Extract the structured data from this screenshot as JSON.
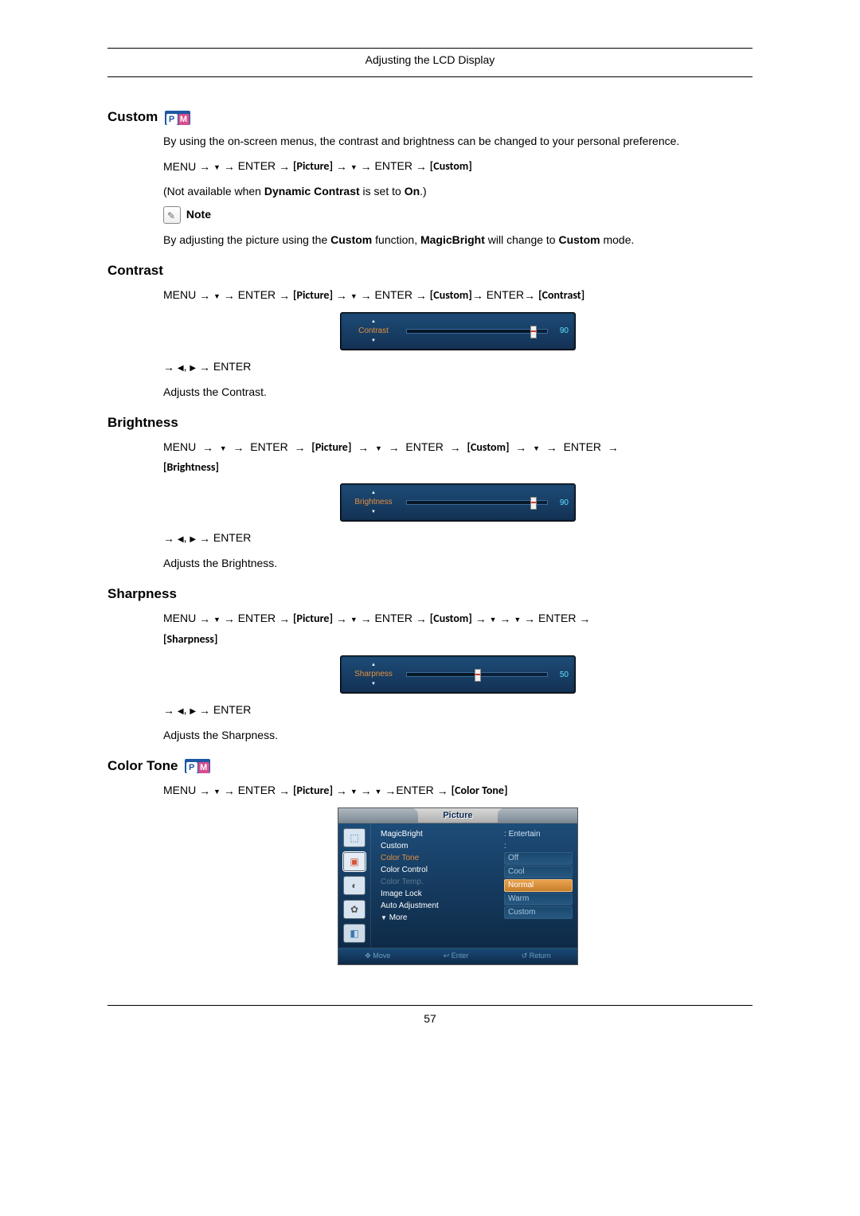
{
  "header": {
    "title": "Adjusting the LCD Display"
  },
  "footer": {
    "page": "57"
  },
  "nav": {
    "menu": "MENU",
    "enter": "ENTER",
    "picture": "Picture",
    "custom": "Custom",
    "contrast": "Contrast",
    "brightness": "Brightness",
    "sharpness": "Sharpness",
    "color_tone": "Color Tone"
  },
  "sections": {
    "custom": {
      "heading": "Custom",
      "para1": "By using the on-screen menus, the contrast and brightness can be changed to your personal preference.",
      "not_avail_prefix": "(Not available when ",
      "not_avail_bold": "Dynamic Contrast",
      "not_avail_mid": " is set to ",
      "not_avail_bold2": "On",
      "not_avail_suffix": ".)",
      "note_label": "Note",
      "note_text_a": "By adjusting the picture using the ",
      "note_text_bold1": "Custom",
      "note_text_b": " function, ",
      "note_text_bold2": "MagicBright",
      "note_text_c": " will change to ",
      "note_text_bold3": "Custom",
      "note_text_d": " mode."
    },
    "contrast": {
      "heading": "Contrast",
      "desc": "Adjusts the Contrast.",
      "slider_label": "Contrast",
      "slider_value": "90",
      "slider_pct": 90
    },
    "brightness": {
      "heading": "Brightness",
      "desc": "Adjusts the Brightness.",
      "slider_label": "Brightness",
      "slider_value": "90",
      "slider_pct": 90
    },
    "sharpness": {
      "heading": "Sharpness",
      "desc": "Adjusts the Sharpness.",
      "slider_label": "Sharpness",
      "slider_value": "50",
      "slider_pct": 50
    },
    "color_tone": {
      "heading": "Color Tone"
    }
  },
  "osd": {
    "title": "Picture",
    "labels": {
      "magicbright": "MagicBright",
      "custom": "Custom",
      "color_tone": "Color Tone",
      "color_control": "Color Control",
      "color_temp": "Color Temp.",
      "image_lock": "Image Lock",
      "auto_adjustment": "Auto Adjustment",
      "more": "More"
    },
    "mb_value": "Entertain",
    "options": [
      "Off",
      "Cool",
      "Normal",
      "Warm",
      "Custom"
    ],
    "selected_option": "Normal",
    "footer": {
      "move": "Move",
      "enter": "Enter",
      "return": "Return"
    }
  }
}
